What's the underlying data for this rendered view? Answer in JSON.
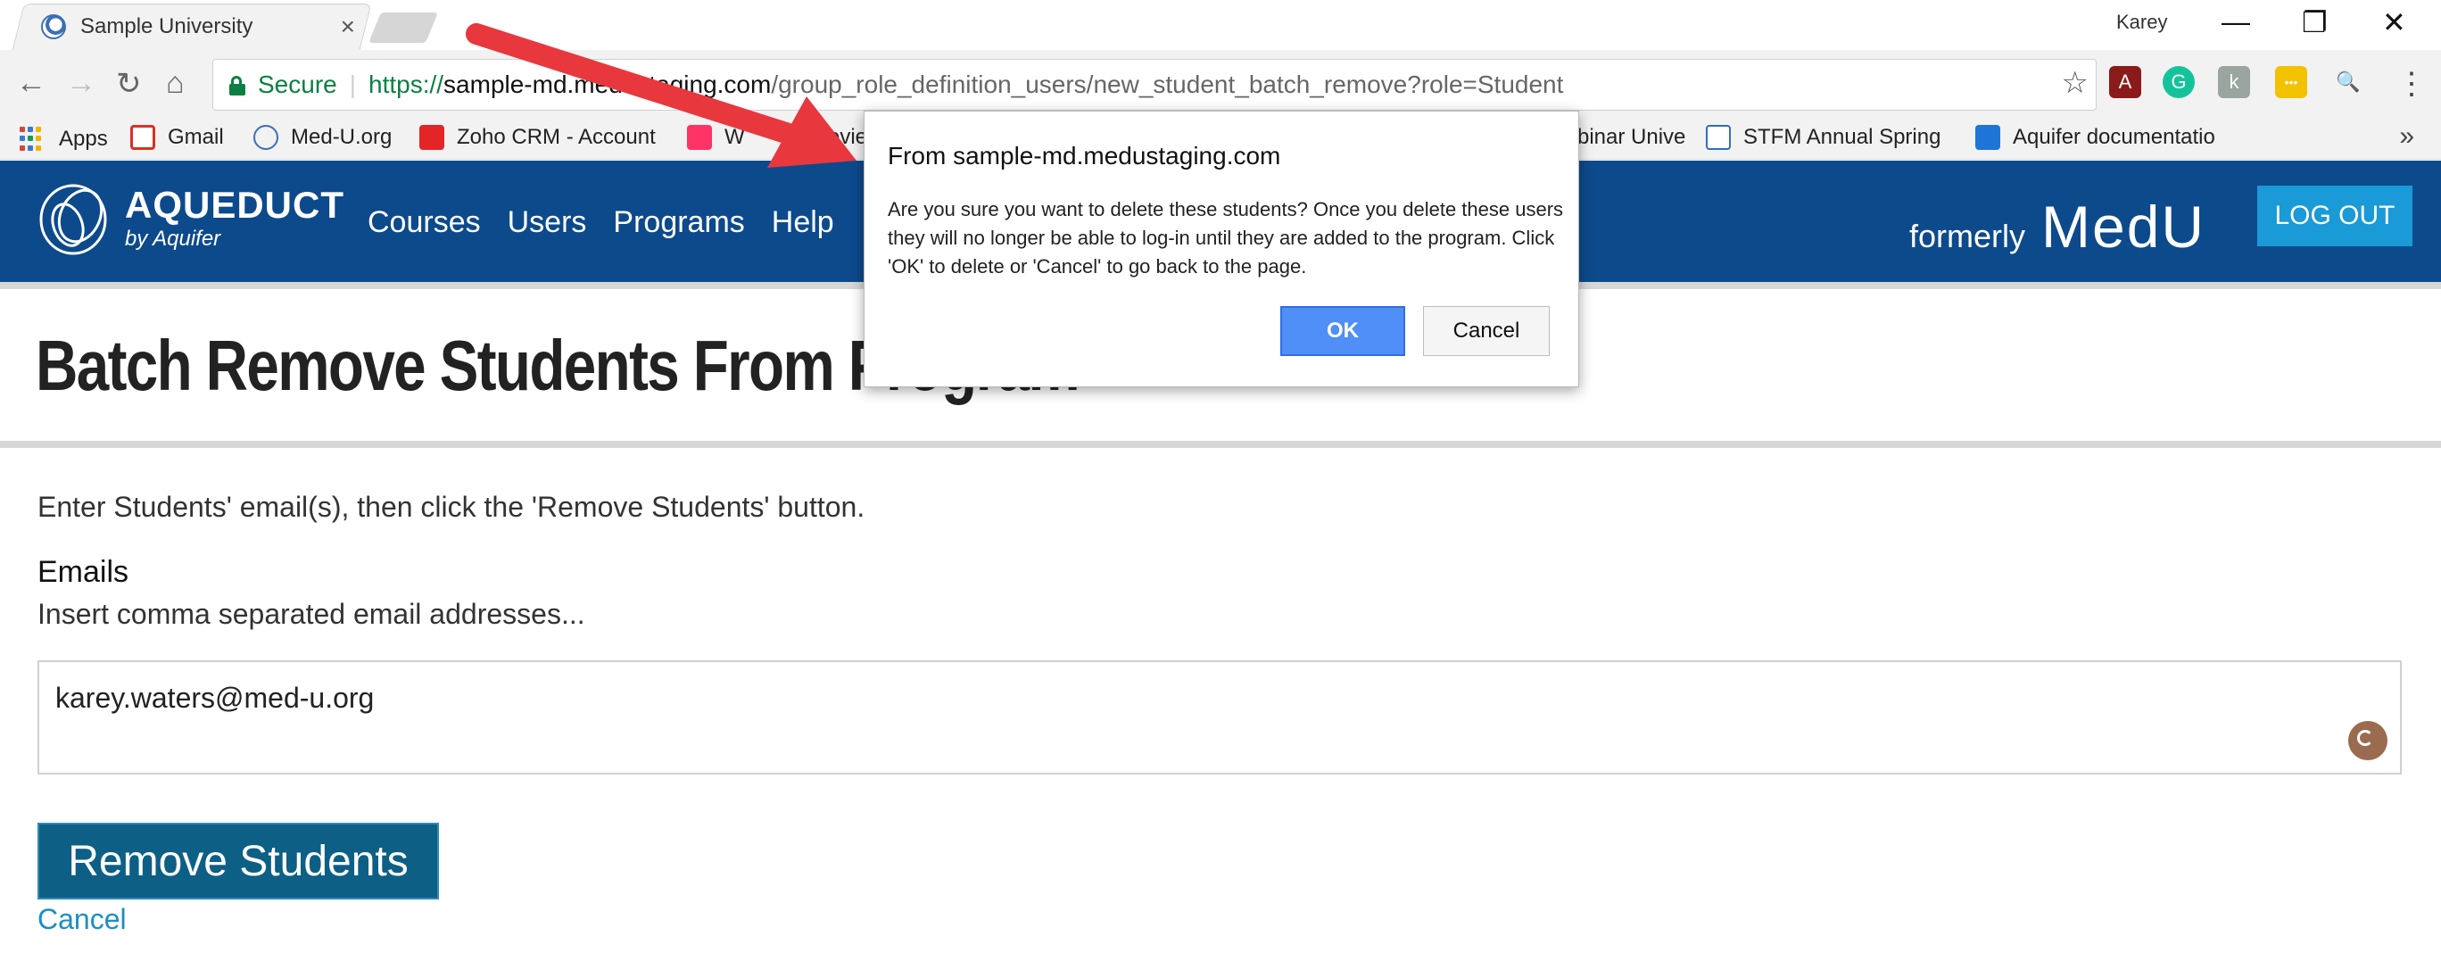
{
  "browser": {
    "tab_title": "Sample University",
    "tab_close_glyph": "×",
    "profile_name": "Karey",
    "window_controls": [
      "—",
      "❐",
      "✕"
    ],
    "nav_glyphs": {
      "back": "←",
      "forward": "→",
      "reload": "↻",
      "home": "⌂",
      "star": "☆"
    },
    "secure_label": "Secure",
    "url": {
      "scheme": "https://",
      "host": "sample-md.medustaging.com",
      "path": "/group_role_definition_users/new_student_batch_remove?role=Student"
    },
    "extensions": [
      {
        "name": "adobe-acrobat-icon",
        "glyph": "A",
        "color": "#8b1a1a"
      },
      {
        "name": "grammarly-icon",
        "glyph": "G",
        "color": "#15c39a"
      },
      {
        "name": "extension-k-icon",
        "glyph": "k",
        "color": "#9aa5a0"
      },
      {
        "name": "yellow-extension-icon",
        "glyph": "•••",
        "color": "#f2c200"
      },
      {
        "name": "search-extension-icon",
        "glyph": "🔍",
        "color": "#f2f2f2"
      }
    ],
    "more_glyph": "⋮"
  },
  "bookmarks": {
    "items": [
      {
        "label": "Apps",
        "icon": "apps-grid-icon"
      },
      {
        "label": "Gmail",
        "icon": "gmail-icon"
      },
      {
        "label": "Med-U.org",
        "icon": "med-u-icon"
      },
      {
        "label": "Zoho CRM - Account",
        "icon": "zoho-icon"
      },
      {
        "label": "W",
        "icon": "invision-icon"
      },
      {
        "label": "revie",
        "icon": ""
      },
      {
        "label": "binar Unive",
        "icon": ""
      },
      {
        "label": "STFM Annual Spring",
        "icon": "stfm-icon"
      },
      {
        "label": "Aquifer documentatio",
        "icon": "dropbox-icon"
      }
    ],
    "overflow": "»"
  },
  "site": {
    "logo_title": "AQUEDUCT",
    "logo_sub": "by Aquifer",
    "nav": [
      "Courses",
      "Users",
      "Programs",
      "Help"
    ],
    "formerly_small": "formerly",
    "formerly_big": "MedU",
    "logout": "LOG OUT"
  },
  "page": {
    "title": "Batch Remove Students From Program",
    "instructions": "Enter Students' email(s), then click the 'Remove Students' button.",
    "emails_label": "Emails",
    "emails_help": "Insert comma separated email addresses...",
    "email_value": "karey.waters@med-u.org",
    "remove_button": "Remove Students",
    "cancel_link": "Cancel"
  },
  "dialog": {
    "title": "From sample-md.medustaging.com",
    "message": "Are you sure you want to delete these students? Once you delete these users they will no longer be able to log-in until they are added to the program. Click 'OK' to delete or 'Cancel' to go back to the page.",
    "ok": "OK",
    "cancel": "Cancel"
  },
  "colors": {
    "header_bg": "#0d4a8c",
    "logout_bg": "#1a9ad6",
    "remove_button_bg": "#0e5f86",
    "link": "#1a8ec6",
    "secure_green": "#0b8043",
    "annotation_arrow": "#e8383d"
  }
}
